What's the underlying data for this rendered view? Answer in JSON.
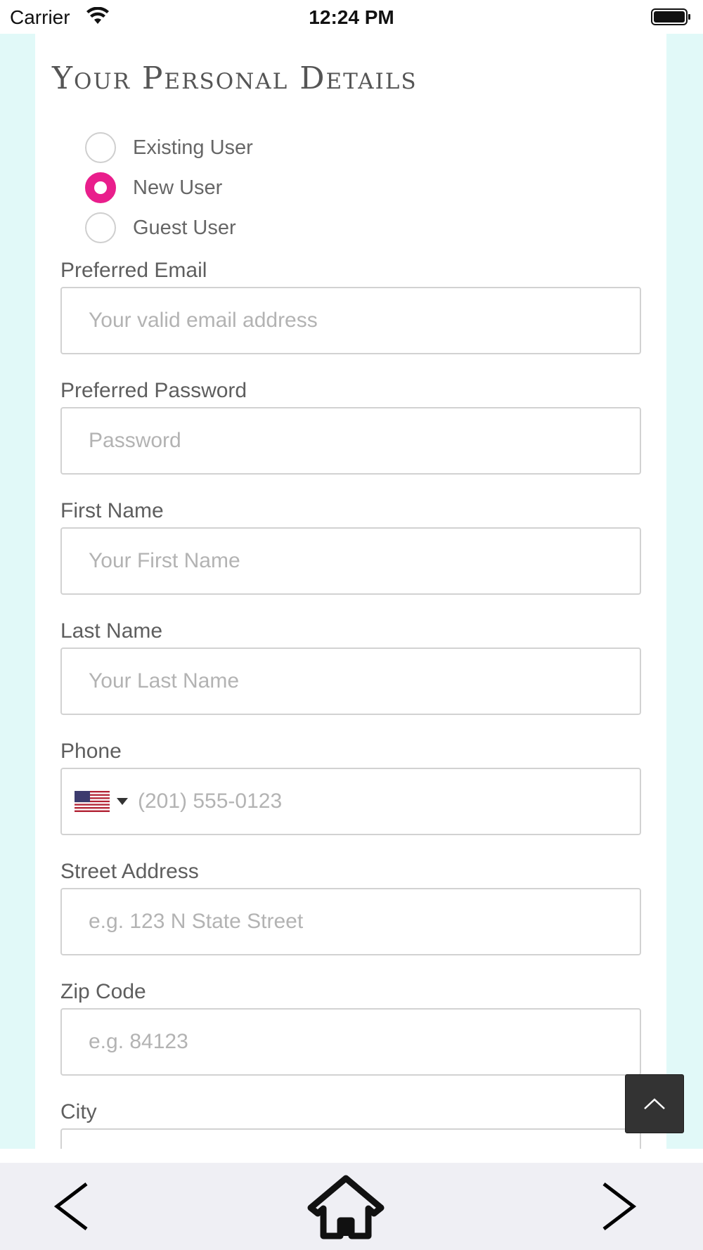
{
  "status_bar": {
    "carrier": "Carrier",
    "time": "12:24 PM"
  },
  "page": {
    "title": "Your Personal Details"
  },
  "user_type": {
    "options": [
      {
        "label": "Existing User",
        "checked": false
      },
      {
        "label": "New User",
        "checked": true
      },
      {
        "label": "Guest User",
        "checked": false
      }
    ],
    "selected": "New User"
  },
  "fields": {
    "email": {
      "label": "Preferred Email",
      "placeholder": "Your valid email address"
    },
    "password": {
      "label": "Preferred Password",
      "placeholder": "Password"
    },
    "first_name": {
      "label": "First Name",
      "placeholder": "Your First Name"
    },
    "last_name": {
      "label": "Last Name",
      "placeholder": "Your Last Name"
    },
    "phone": {
      "label": "Phone",
      "placeholder": "(201) 555-0123",
      "country_flag": "us-flag-icon"
    },
    "street": {
      "label": "Street Address",
      "placeholder": "e.g. 123 N State Street"
    },
    "zip": {
      "label": "Zip Code",
      "placeholder": "e.g. 84123"
    },
    "city": {
      "label": "City",
      "placeholder": ""
    }
  },
  "toolbar": {
    "back_icon": "chevron-left-icon",
    "home_icon": "home-icon",
    "forward_icon": "chevron-right-icon"
  },
  "colors": {
    "accent": "#e91e8c",
    "side_background": "#e1f9f8",
    "toolbar_background": "#efeff4",
    "scroll_top_button": "#333333"
  }
}
